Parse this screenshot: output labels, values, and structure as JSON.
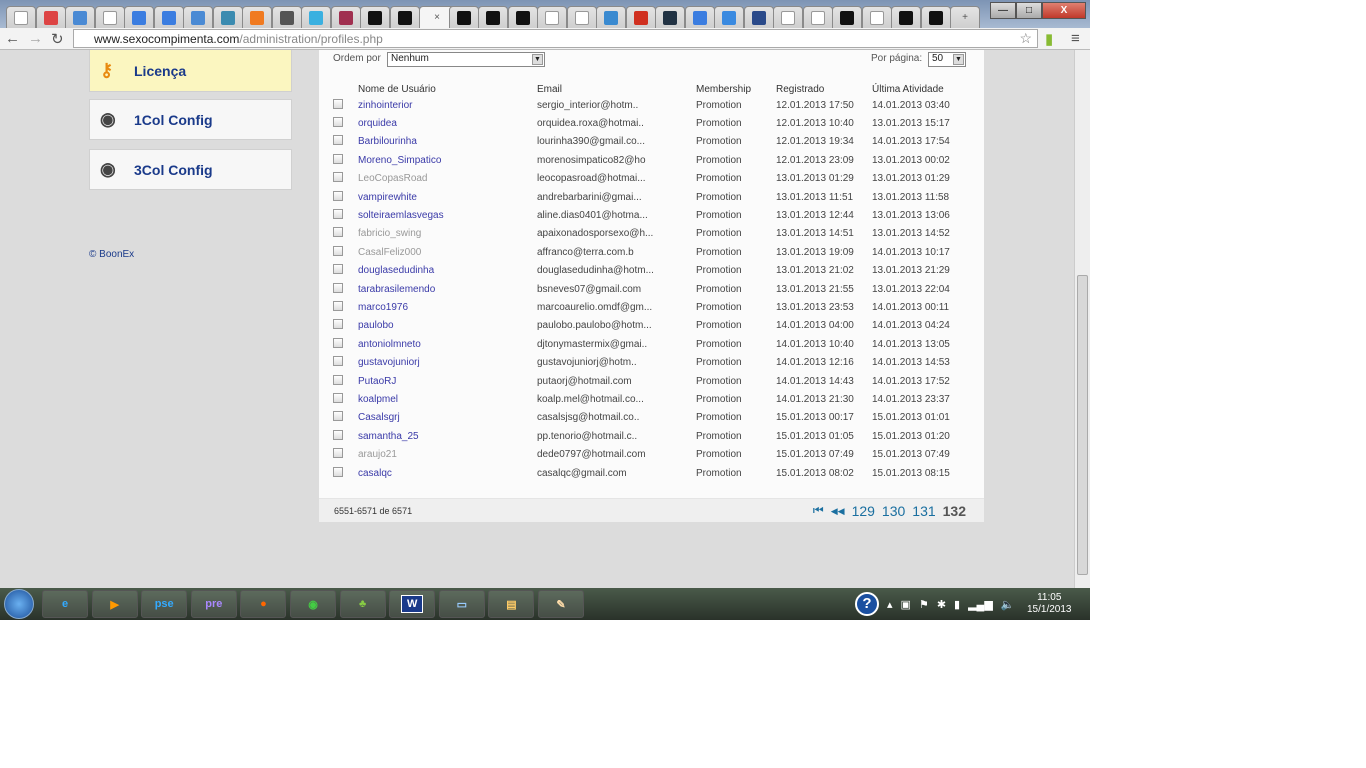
{
  "browser": {
    "tabs": [
      "page-icon",
      "gmail-icon",
      "translate-icon",
      "page-icon",
      "google-icon",
      "google-icon",
      "translate-icon",
      "app-icon",
      "blogger-icon",
      "globe-icon",
      "twitter-icon",
      "flower-icon",
      "infinity-icon",
      "infinity-icon",
      "close",
      "infinity-icon",
      "infinity-icon",
      "infinity-icon",
      "page-icon",
      "page-icon",
      "chrome-app-icon",
      "chart-icon",
      "c-icon",
      "google-icon",
      "d-icon",
      "ieee-icon",
      "page-icon",
      "page-icon",
      "infinity-icon",
      "page-icon",
      "infinity-icon",
      "infinity-icon"
    ],
    "active_tab_close": "×",
    "url_domain": "www.sexocompimenta.com",
    "url_path": "/administration/profiles.php",
    "window_controls": {
      "minimize": "—",
      "maximize": "□",
      "close": "X"
    }
  },
  "sidebar": {
    "items": [
      {
        "label": "Licença",
        "icon": "key-icon"
      },
      {
        "label": "1Col Config",
        "icon": "webcam-icon"
      },
      {
        "label": "3Col Config",
        "icon": "webcam-icon"
      }
    ],
    "copyright": "© BoonEx"
  },
  "controls": {
    "order_label": "Ordem por",
    "order_value": "Nenhum",
    "per_page_label": "Por página:",
    "per_page_value": "50"
  },
  "table": {
    "headers": [
      "Nome de Usuário",
      "Email",
      "Membership",
      "Registrado",
      "Última Atividade"
    ],
    "rows": [
      {
        "name": "zinhointerior",
        "email": "sergio_interior@hotm..",
        "membership": "Promotion",
        "registered": "12.01.2013 17:50",
        "last": "14.01.2013 03:40",
        "status": "active"
      },
      {
        "name": "orquidea",
        "email": "orquidea.roxa@hotmai..",
        "membership": "Promotion",
        "registered": "12.01.2013 10:40",
        "last": "13.01.2013 15:17",
        "status": "active"
      },
      {
        "name": "Barbilourinha",
        "email": "lourinha390@gmail.co...",
        "membership": "Promotion",
        "registered": "12.01.2013 19:34",
        "last": "14.01.2013 17:54",
        "status": "active"
      },
      {
        "name": "Moreno_Simpatico",
        "email": "morenosimpatico82@ho",
        "membership": "Promotion",
        "registered": "12.01.2013 23:09",
        "last": "13.01.2013 00:02",
        "status": "active"
      },
      {
        "name": "LeoCopasRoad",
        "email": "leocopasroad@hotmai...",
        "membership": "Promotion",
        "registered": "13.01.2013 01:29",
        "last": "13.01.2013 01:29",
        "status": "inactive"
      },
      {
        "name": "vampirewhite",
        "email": "andrebarbarini@gmai...",
        "membership": "Promotion",
        "registered": "13.01.2013 11:51",
        "last": "13.01.2013 11:58",
        "status": "active"
      },
      {
        "name": "solteiraemlasvegas",
        "email": "aline.dias0401@hotma...",
        "membership": "Promotion",
        "registered": "13.01.2013 12:44",
        "last": "13.01.2013 13:06",
        "status": "active"
      },
      {
        "name": "fabricio_swing",
        "email": "apaixonadosporsexo@h...",
        "membership": "Promotion",
        "registered": "13.01.2013 14:51",
        "last": "13.01.2013 14:52",
        "status": "inactive"
      },
      {
        "name": "CasalFeliz000",
        "email": "affranco@terra.com.b",
        "membership": "Promotion",
        "registered": "13.01.2013 19:09",
        "last": "14.01.2013 10:17",
        "status": "inactive"
      },
      {
        "name": "douglasedudinha",
        "email": "douglasedudinha@hotm...",
        "membership": "Promotion",
        "registered": "13.01.2013 21:02",
        "last": "13.01.2013 21:29",
        "status": "active"
      },
      {
        "name": "tarabrasilemendo",
        "email": "bsneves07@gmail.com",
        "membership": "Promotion",
        "registered": "13.01.2013 21:55",
        "last": "13.01.2013 22:04",
        "status": "active"
      },
      {
        "name": "marco1976",
        "email": "marcoaurelio.omdf@gm...",
        "membership": "Promotion",
        "registered": "13.01.2013 23:53",
        "last": "14.01.2013 00:11",
        "status": "active"
      },
      {
        "name": "paulobo",
        "email": "paulobo.paulobo@hotm...",
        "membership": "Promotion",
        "registered": "14.01.2013 04:00",
        "last": "14.01.2013 04:24",
        "status": "active"
      },
      {
        "name": "antoniolmneto",
        "email": "djtonymastermix@gmai..",
        "membership": "Promotion",
        "registered": "14.01.2013 10:40",
        "last": "14.01.2013 13:05",
        "status": "active"
      },
      {
        "name": "gustavojuniorj",
        "email": "gustavojuniorj@hotm..",
        "membership": "Promotion",
        "registered": "14.01.2013 12:16",
        "last": "14.01.2013 14:53",
        "status": "active"
      },
      {
        "name": "PutaoRJ",
        "email": "putaorj@hotmail.com",
        "membership": "Promotion",
        "registered": "14.01.2013 14:43",
        "last": "14.01.2013 17:52",
        "status": "active"
      },
      {
        "name": "koalpmel",
        "email": "koalp.mel@hotmail.co...",
        "membership": "Promotion",
        "registered": "14.01.2013 21:30",
        "last": "14.01.2013 23:37",
        "status": "active"
      },
      {
        "name": "Casalsgrj",
        "email": "casalsjsg@hotmail.co..",
        "membership": "Promotion",
        "registered": "15.01.2013 00:17",
        "last": "15.01.2013 01:01",
        "status": "active"
      },
      {
        "name": "samantha_25",
        "email": "pp.tenorio@hotmail.c..",
        "membership": "Promotion",
        "registered": "15.01.2013 01:05",
        "last": "15.01.2013 01:20",
        "status": "active"
      },
      {
        "name": "araujo21",
        "email": "dede0797@hotmail.com",
        "membership": "Promotion",
        "registered": "15.01.2013 07:49",
        "last": "15.01.2013 07:49",
        "status": "inactive"
      },
      {
        "name": "casalqc",
        "email": "casalqc@gmail.com",
        "membership": "Promotion",
        "registered": "15.01.2013 08:02",
        "last": "15.01.2013 08:15",
        "status": "active"
      }
    ]
  },
  "footer": {
    "count": "6551-6571 de 6571",
    "first": "⏮",
    "prev": "◀◀",
    "pages": [
      "129",
      "130",
      "131",
      "132"
    ],
    "current": "132"
  },
  "taskbar": {
    "items": [
      {
        "icon": "ie-icon",
        "label": "e"
      },
      {
        "icon": "media-player-icon",
        "label": "▶"
      },
      {
        "icon": "photoshop-elements-icon",
        "label": "pse"
      },
      {
        "icon": "premiere-elements-icon",
        "label": "pre"
      },
      {
        "icon": "firefox-icon",
        "label": "●"
      },
      {
        "icon": "chrome-icon",
        "label": "◉"
      },
      {
        "icon": "messenger-icon",
        "label": "♣"
      },
      {
        "icon": "word-icon",
        "label": "W"
      },
      {
        "icon": "photo-viewer-icon",
        "label": "▭"
      },
      {
        "icon": "explorer-icon",
        "label": "▤"
      },
      {
        "icon": "paint-icon",
        "label": "✎"
      }
    ],
    "help": "?",
    "time": "11:05",
    "date": "15/1/2013"
  },
  "colors": {
    "link": "#3a3aa8",
    "inactive": "#999999",
    "pager": "#1a6fa0",
    "license_bg": "#fbf6c0"
  }
}
